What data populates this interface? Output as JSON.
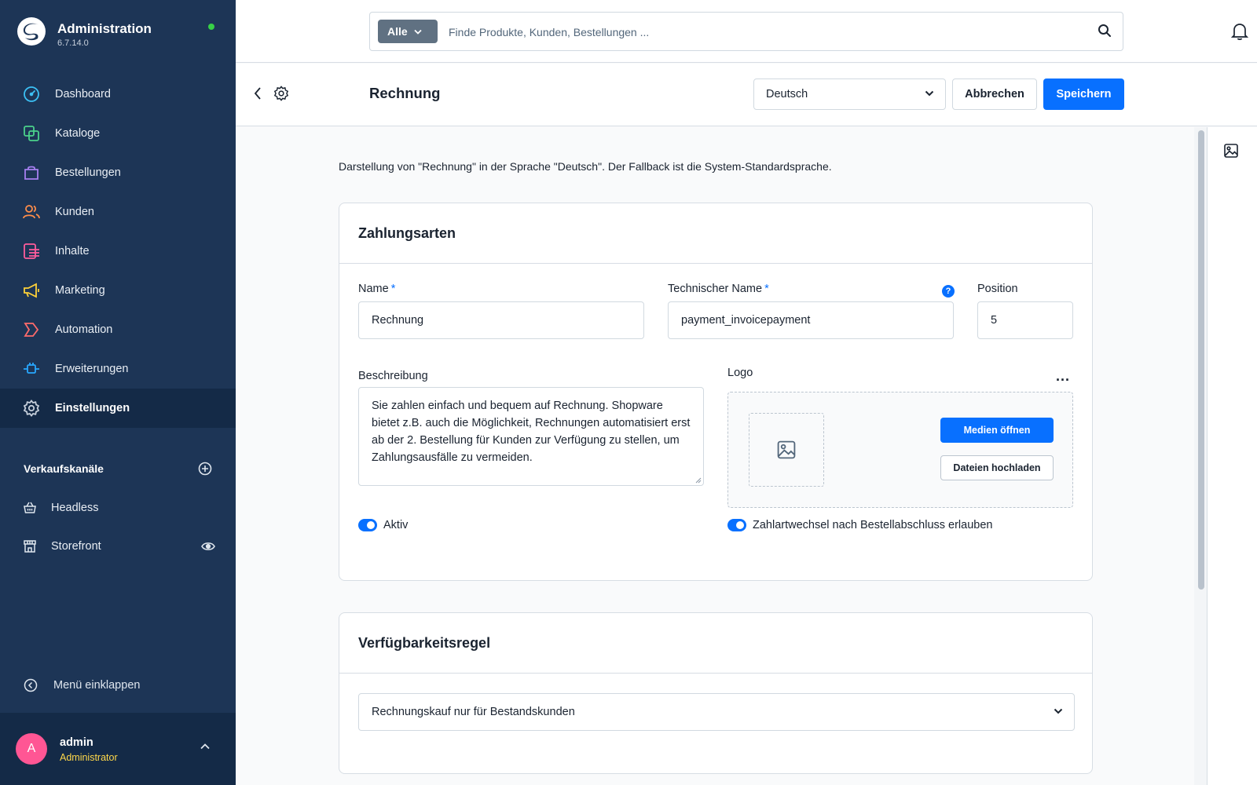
{
  "app": {
    "title": "Administration",
    "version": "6.7.14.0"
  },
  "nav": [
    {
      "label": "Dashboard",
      "icon": "dashboard-icon",
      "color": "#3cc1f5"
    },
    {
      "label": "Kataloge",
      "icon": "catalog-icon",
      "color": "#4bd18b"
    },
    {
      "label": "Bestellungen",
      "icon": "bag-icon",
      "color": "#a67ff0"
    },
    {
      "label": "Kunden",
      "icon": "users-icon",
      "color": "#ff8d4a"
    },
    {
      "label": "Inhalte",
      "icon": "content-icon",
      "color": "#ff5c9c"
    },
    {
      "label": "Marketing",
      "icon": "megaphone-icon",
      "color": "#ffd138"
    },
    {
      "label": "Automation",
      "icon": "automation-icon",
      "color": "#ff6b6b"
    },
    {
      "label": "Erweiterungen",
      "icon": "plugin-icon",
      "color": "#28a8ff"
    },
    {
      "label": "Einstellungen",
      "icon": "gear-icon",
      "color": "#c7d0dc",
      "active": true
    }
  ],
  "sales_channels": {
    "title": "Verkaufskanäle",
    "items": [
      {
        "label": "Headless",
        "icon": "basket-icon"
      },
      {
        "label": "Storefront",
        "icon": "storefront-icon"
      }
    ]
  },
  "collapse_label": "Menü einklappen",
  "user": {
    "initial": "A",
    "name": "admin",
    "role": "Administrator"
  },
  "search": {
    "scope": "Alle",
    "placeholder": "Finde Produkte, Kunden, Bestellungen ..."
  },
  "header": {
    "title": "Rechnung",
    "language": "Deutsch",
    "cancel_label": "Abbrechen",
    "save_label": "Speichern"
  },
  "lang_info": "Darstellung von \"Rechnung\" in der Sprache \"Deutsch\". Der Fallback ist die System-Standardsprache.",
  "payment_card": {
    "title": "Zahlungsarten",
    "name_label": "Name",
    "name_value": "Rechnung",
    "tech_label": "Technischer Name",
    "tech_value": "payment_invoicepayment",
    "position_label": "Position",
    "position_value": "5",
    "description_label": "Beschreibung",
    "description_value": "Sie zahlen einfach und bequem auf Rechnung. Shopware bietet z.B. auch die Möglichkeit, Rechnungen automatisiert erst ab der 2. Bestellung für Kunden zur Verfügung zu stellen, um Zahlungsausfälle zu vermeiden.",
    "logo_label": "Logo",
    "media_button": "Medien öffnen",
    "upload_button": "Dateien hochladen",
    "active_label": "Aktiv",
    "switch_label": "Zahlartwechsel nach Bestellabschluss erlauben",
    "required_mark": "*",
    "help_mark": "?",
    "more_mark": "..."
  },
  "rule_card": {
    "title": "Verfügbarkeitsregel",
    "value": "Rechnungskauf nur für Bestandskunden"
  },
  "colors": {
    "sidebar": "#1d3556",
    "primary": "#0870ff",
    "avatar": "#ff5694"
  }
}
